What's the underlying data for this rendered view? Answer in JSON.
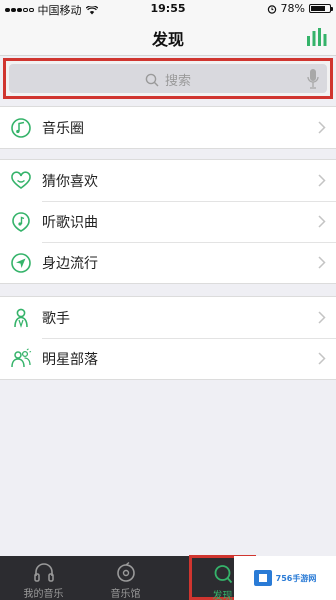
{
  "status_bar": {
    "carrier": "中国移动",
    "time": "19:55",
    "battery": "78%",
    "battery_level": 0.78
  },
  "nav": {
    "title": "发现",
    "right_icon": "equalizer-icon"
  },
  "search": {
    "placeholder": "搜索"
  },
  "groups": [
    {
      "items": [
        {
          "label": "音乐圈",
          "icon": "music-circle-icon"
        }
      ]
    },
    {
      "items": [
        {
          "label": "猜你喜欢",
          "icon": "heart-icon"
        },
        {
          "label": "听歌识曲",
          "icon": "music-note-icon"
        },
        {
          "label": "身边流行",
          "icon": "location-arrow-icon"
        }
      ]
    },
    {
      "items": [
        {
          "label": "歌手",
          "icon": "singer-icon"
        },
        {
          "label": "明星部落",
          "icon": "star-group-icon"
        }
      ]
    }
  ],
  "tabs": [
    {
      "label": "我的音乐",
      "icon": "headphones-icon"
    },
    {
      "label": "音乐馆",
      "icon": "music-hall-icon"
    },
    {
      "label": "发现",
      "icon": "discover-search-icon",
      "active": true
    }
  ],
  "watermark": {
    "text": "756手游网"
  },
  "colors": {
    "accent": "#35b36a",
    "highlight_border": "#d0352f",
    "tab_bar_bg": "#2c2c30",
    "page_bg": "#efeff4"
  }
}
